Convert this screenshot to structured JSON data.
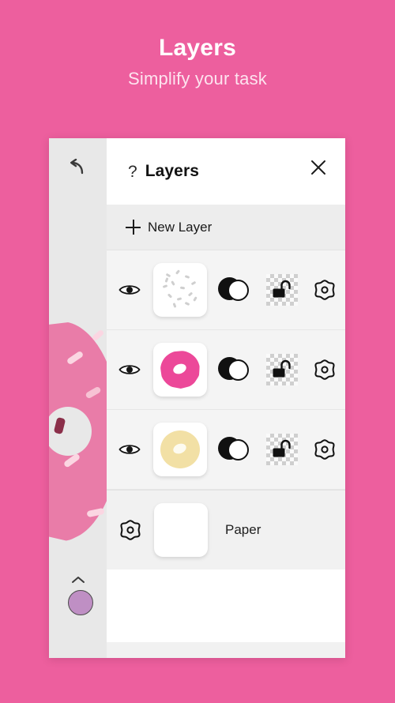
{
  "promo": {
    "title": "Layers",
    "subtitle": "Simplify your task",
    "background_color": "#ed5f9e",
    "title_color": "#ffffff",
    "subtitle_color": "#fde4ef"
  },
  "toolbar": {
    "undo_icon": "undo-arrow-icon",
    "collapse_icon": "chevron-up-icon",
    "color_swatch": "#bf8fc4"
  },
  "panel": {
    "help_icon": "?",
    "title": "Layers",
    "close_icon": "close-x-icon",
    "new_layer_label": "New Layer",
    "new_layer_icon": "plus-icon"
  },
  "layers": [
    {
      "name": "layer-sprinkles",
      "visible_icon": "eye-icon",
      "thumbnail": "sprinkles-thumbnail",
      "thumbnail_color": "#ffffff",
      "blend_icon": "blend-mode-icon",
      "lock_icon": "unlock-icon",
      "settings_icon": "gear-icon"
    },
    {
      "name": "layer-pink-donut",
      "visible_icon": "eye-icon",
      "thumbnail": "pink-donut-thumbnail",
      "thumbnail_color": "#ec4899",
      "blend_icon": "blend-mode-icon",
      "lock_icon": "unlock-icon",
      "settings_icon": "gear-icon"
    },
    {
      "name": "layer-cream-donut",
      "visible_icon": "eye-icon",
      "thumbnail": "cream-donut-thumbnail",
      "thumbnail_color": "#f2e0a5",
      "blend_icon": "blend-mode-icon",
      "lock_icon": "unlock-icon",
      "settings_icon": "gear-icon"
    }
  ],
  "paper": {
    "settings_icon": "gear-icon",
    "thumbnail": "paper-thumbnail",
    "label": "Paper"
  },
  "canvas": {
    "artwork": "pink-donut-with-sprinkles",
    "dough_color": "#e97ca8",
    "sprinkle_colors": [
      "#fbd6e2",
      "#8b2f4a",
      "#f7c2d4"
    ]
  }
}
